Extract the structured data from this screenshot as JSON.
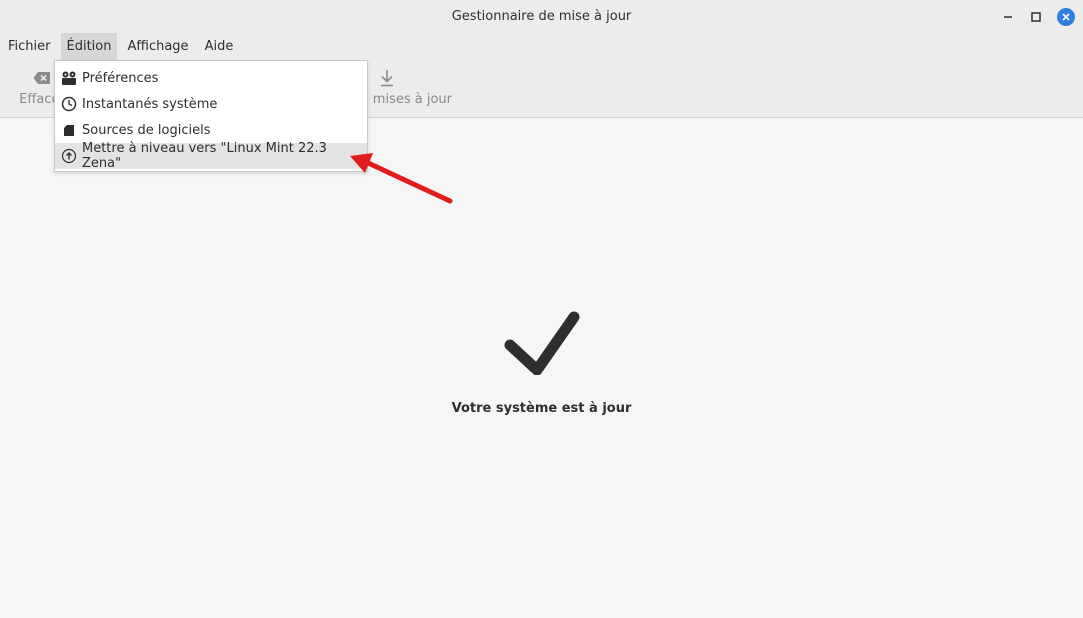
{
  "window": {
    "title": "Gestionnaire de mise à jour",
    "controls": {
      "minimize_icon": "minimize-icon",
      "maximize_icon": "maximize-icon",
      "close_icon": "close-icon"
    }
  },
  "menubar": {
    "items": [
      {
        "label": "Fichier"
      },
      {
        "label": "Édition",
        "active": true
      },
      {
        "label": "Affichage"
      },
      {
        "label": "Aide"
      }
    ]
  },
  "toolbar": {
    "clear": {
      "label": "Effacer",
      "icon": "clear-icon"
    },
    "install": {
      "label": "es mises à jour",
      "icon": "download-icon"
    }
  },
  "edit_menu": {
    "items": [
      {
        "label": "Préférences",
        "icon": "preferences-icon"
      },
      {
        "label": "Instantanés système",
        "icon": "clock-icon"
      },
      {
        "label": "Sources de logiciels",
        "icon": "package-icon"
      },
      {
        "label": "Mettre à niveau vers \"Linux Mint 22.3 Zena\"",
        "icon": "upgrade-icon",
        "highlighted": true
      }
    ]
  },
  "status": {
    "icon": "checkmark-icon",
    "text": "Votre système est à jour"
  },
  "annotation": {
    "icon": "red-arrow-icon",
    "color": "#e11c1c"
  },
  "colors": {
    "close_button": "#2f7fe0",
    "arrow": "#e11c1c"
  }
}
